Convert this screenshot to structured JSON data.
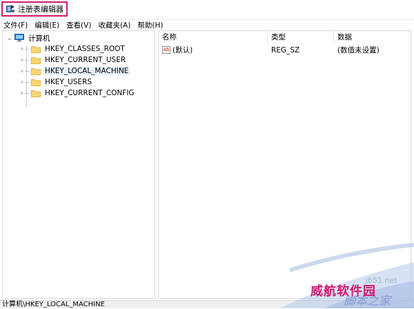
{
  "window": {
    "title": "注册表编辑器"
  },
  "menu": [
    {
      "label": "文件(F)"
    },
    {
      "label": "编辑(E)"
    },
    {
      "label": "查看(V)"
    },
    {
      "label": "收藏夹(A)"
    },
    {
      "label": "帮助(H)"
    }
  ],
  "tree": {
    "root": "计算机",
    "items": [
      {
        "label": "HKEY_CLASSES_ROOT"
      },
      {
        "label": "HKEY_CURRENT_USER"
      },
      {
        "label": "HKEY_LOCAL_MACHINE",
        "selected": true
      },
      {
        "label": "HKEY_USERS"
      },
      {
        "label": "HKEY_CURRENT_CONFIG"
      }
    ]
  },
  "list": {
    "columns": [
      "名称",
      "类型",
      "数据"
    ],
    "rows": [
      {
        "name": "(默认)",
        "type": "REG_SZ",
        "data": "(数值未设置)"
      }
    ]
  },
  "status": {
    "path": "计算机\\HKEY_LOCAL_MACHINE"
  },
  "watermark": {
    "url": "jb51.net",
    "brand": "威航软件园",
    "site": "脚本之家"
  },
  "colors": {
    "highlight": "#d11a6e",
    "selection": "#e5f1fb"
  }
}
